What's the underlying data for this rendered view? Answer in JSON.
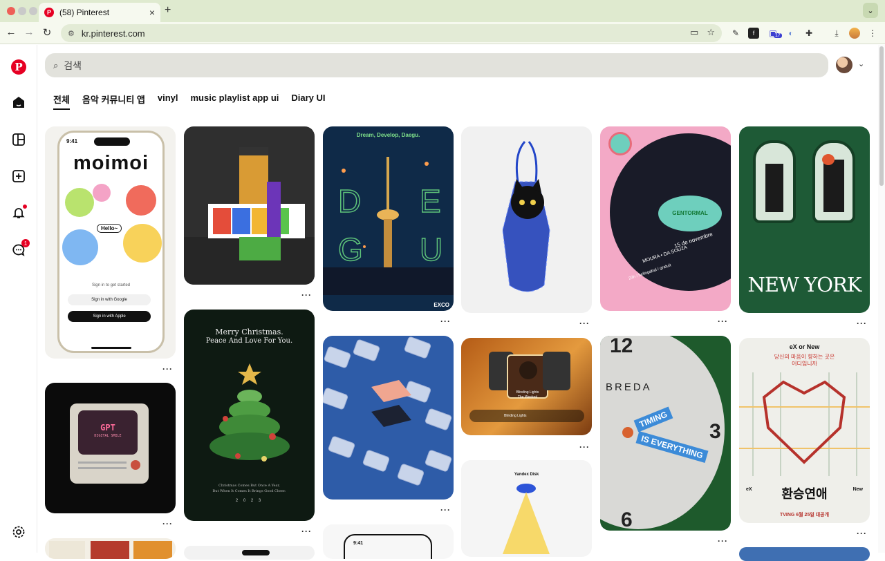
{
  "browser": {
    "tab_title": "(58) Pinterest",
    "tab_close": "×",
    "new_tab": "+",
    "url": "kr.pinterest.com",
    "extension_badge": "17"
  },
  "pinterest": {
    "search_placeholder": "검색",
    "chips": [
      "전체",
      "음악 커뮤니티 앱",
      "vinyl",
      "music playlist app ui",
      "Diary UI"
    ],
    "messages_badge": "1",
    "more_label": "···",
    "pins": {
      "moimoi": {
        "time": "9:41",
        "title": "moimoi",
        "hello": "Hello~",
        "signin": "Sign in to get started",
        "google": "Sign in with Google",
        "apple": "Sign in with Apple"
      },
      "gpt": {
        "title": "GPT",
        "sub": "DIGITAL SMILE"
      },
      "christmas": {
        "line1": "Merry Christmas.",
        "line2": "Peace And Love For You.",
        "footer1": "Christmas Comes But Once A Year,",
        "footer2": "But When It Comes It Brings Good Cheer.",
        "date": "2 0 2 3"
      },
      "daegu": {
        "top": "Dream, Develop, Daegu.",
        "brand": "EXCO"
      },
      "blinding": {
        "line1": "Blinding Lights",
        "line2": "The Weeknd",
        "bar": "Blinding Lights"
      },
      "yandex": {
        "title": "Yandex Disk"
      },
      "vinyl": {
        "brand": "GENTORMAL",
        "line1": "15 de novembre",
        "line2": "MOURA • DA SOUZA",
        "line3": "23h / hellogabal / gratuit"
      },
      "newyork": {
        "title": "NEW YORK"
      },
      "breda": {
        "brand": "BREDA",
        "timing": "TIMING",
        "is_every": "IS EVERYTHING",
        "n12": "12",
        "n3": "3",
        "n6": "6"
      },
      "exnew": {
        "top": "eX or New",
        "sub1": "당신의 마음이 향하는 곳은",
        "sub2": "어디입니까",
        "label_left": "eX",
        "label_right": "New",
        "title": "환승연애",
        "tving": "TVING 6월 25일 대공개"
      }
    }
  }
}
